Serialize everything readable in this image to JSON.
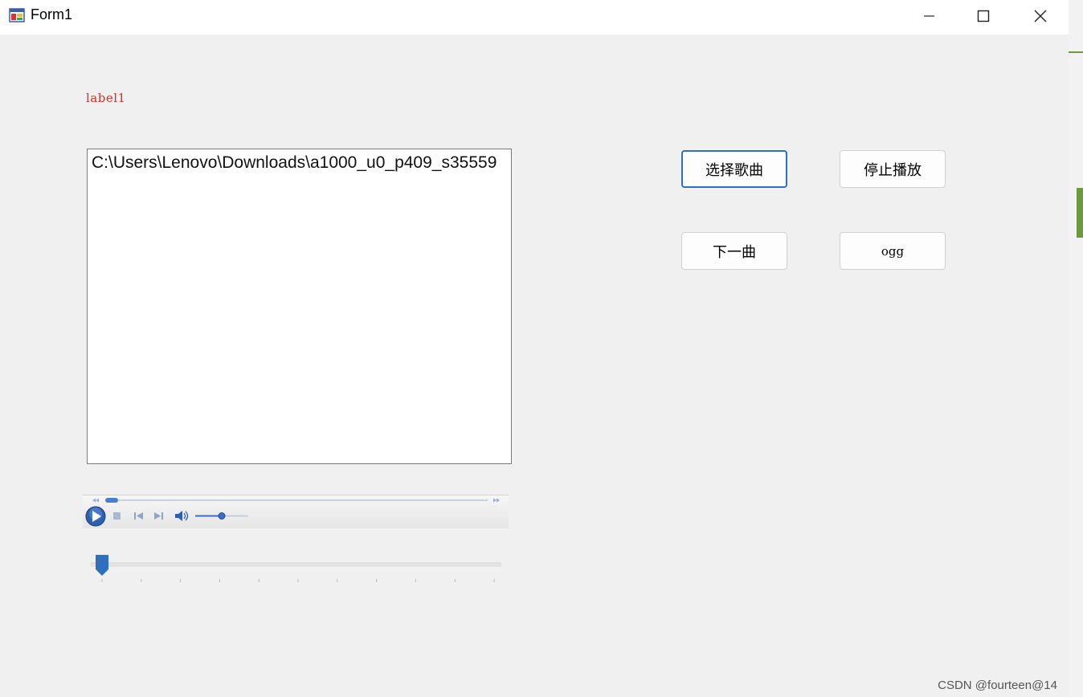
{
  "window": {
    "title": "Form1"
  },
  "form": {
    "label": "label1",
    "listbox_items": [
      "C:\\Users\\Lenovo\\Downloads\\a1000_u0_p409_s35559"
    ],
    "buttons": {
      "select_song": "选择歌曲",
      "stop_playing": "停止播放",
      "next_song": "下一曲",
      "ogg": "ogg"
    },
    "media_player": {
      "volume_fraction": 0.5,
      "position_fraction": 0.0
    },
    "trackbar": {
      "value": 0,
      "tick_count": 11
    }
  },
  "watermark": "CSDN @fourteen@14",
  "colors": {
    "label": "#d2302a",
    "accent": "#2f6fbf",
    "window_bg": "#f0f0f0"
  }
}
